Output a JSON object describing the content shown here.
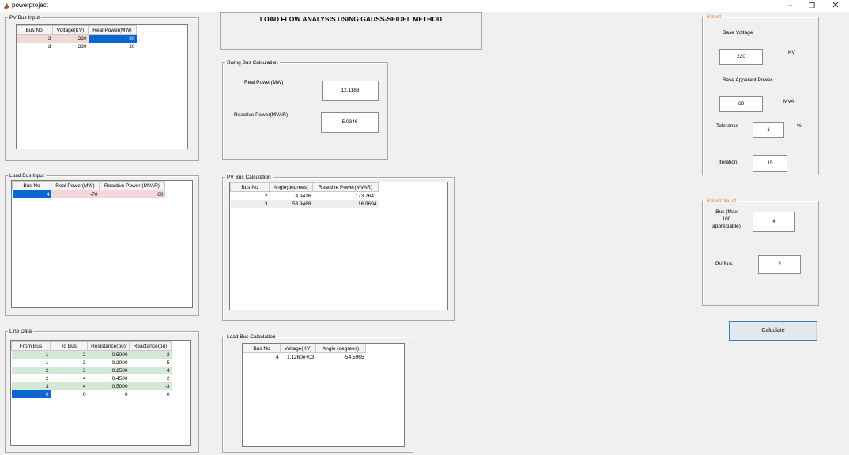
{
  "window": {
    "title": "powerproject",
    "min": "–",
    "restore": "❐",
    "close": "✕"
  },
  "pv_bus_input": {
    "title": "PV Bus Input",
    "headers": [
      "Bus No.",
      "Voltage(KV)",
      "Real  Power(MW)"
    ],
    "rows": [
      [
        "2",
        "220",
        "80"
      ],
      [
        "3",
        "220",
        "20"
      ]
    ]
  },
  "load_bus_input": {
    "title": "Load Bus Input",
    "headers": [
      "Bus No",
      "Real Power(MW)",
      "Reactive Power (MVAR)"
    ],
    "rows": [
      [
        "4",
        "-70",
        "60"
      ]
    ]
  },
  "line_data": {
    "title": "Line Data",
    "headers": [
      "From Bus",
      "To Bus",
      "Resistance(pu)",
      "Reactance(pu)"
    ],
    "rows": [
      [
        "1",
        "2",
        "0.5000",
        "-2"
      ],
      [
        "1",
        "3",
        "0.2000",
        "-5"
      ],
      [
        "2",
        "3",
        "0.2500",
        "4"
      ],
      [
        "2",
        "4",
        "0.4500",
        "2"
      ],
      [
        "3",
        "4",
        "0.5000",
        "-3"
      ],
      [
        "0",
        "0",
        "0",
        "0"
      ]
    ]
  },
  "main_title": "LOAD  FLOW  ANALYSIS USING GAUSS-SEIDEL METHOD",
  "swing": {
    "title": "Swing Bus Calculation",
    "real_label": "Real Power(MW)",
    "real_value": "12.1183",
    "reactive_label": "Reactive Power(MVAR)",
    "reactive_value": "5.0346"
  },
  "pv_calc": {
    "title": "PV Bus Calculation",
    "headers": [
      "Bus No",
      "Angle(degrees)",
      "Reactive Power(MVAR)"
    ],
    "rows": [
      [
        "2",
        "4.9416",
        "173.7641"
      ],
      [
        "3",
        "53.9468",
        "16.9694"
      ]
    ]
  },
  "load_calc": {
    "title": "Load Bus Calculation",
    "headers": [
      "Bus No",
      "Voltage(KV)",
      "Angle (degrees)"
    ],
    "rows": [
      [
        "4",
        "1.1260e+03",
        "-54.5965"
      ]
    ]
  },
  "select": {
    "title": "Select",
    "base_voltage_label": "Base Voltage",
    "base_voltage_value": "220",
    "kv_unit": "KV",
    "base_power_label": "Base Apparant Power",
    "base_power_value": "60",
    "mva_unit": "MVA",
    "tolerance_label": "Tolerance",
    "tolerance_value": "1",
    "percent_unit": "%",
    "iteration_label": "Iteration",
    "iteration_value": "15"
  },
  "select_no": {
    "title": "Select No. of",
    "bus_label_1": "Bus (Max",
    "bus_label_2": "100",
    "bus_label_3": "appreciable)",
    "bus_value": "4",
    "pv_label": "PV Bus",
    "pv_value": "2"
  },
  "calculate_label": "Calculate"
}
